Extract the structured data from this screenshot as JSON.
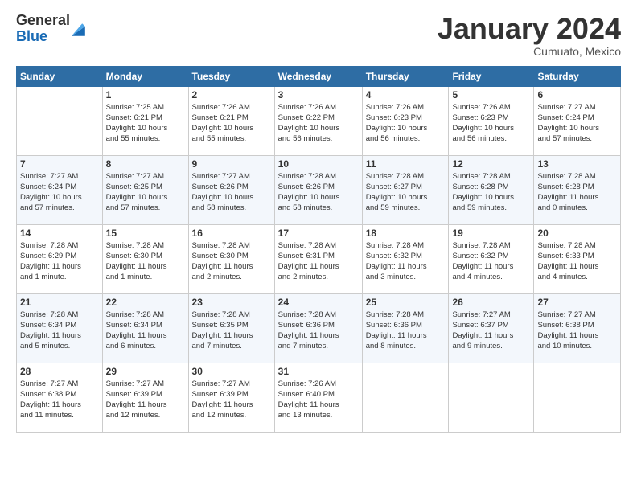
{
  "header": {
    "logo_general": "General",
    "logo_blue": "Blue",
    "month_title": "January 2024",
    "location": "Cumuato, Mexico"
  },
  "days_of_week": [
    "Sunday",
    "Monday",
    "Tuesday",
    "Wednesday",
    "Thursday",
    "Friday",
    "Saturday"
  ],
  "weeks": [
    [
      {
        "day": "",
        "info": ""
      },
      {
        "day": "1",
        "info": "Sunrise: 7:25 AM\nSunset: 6:21 PM\nDaylight: 10 hours\nand 55 minutes."
      },
      {
        "day": "2",
        "info": "Sunrise: 7:26 AM\nSunset: 6:21 PM\nDaylight: 10 hours\nand 55 minutes."
      },
      {
        "day": "3",
        "info": "Sunrise: 7:26 AM\nSunset: 6:22 PM\nDaylight: 10 hours\nand 56 minutes."
      },
      {
        "day": "4",
        "info": "Sunrise: 7:26 AM\nSunset: 6:23 PM\nDaylight: 10 hours\nand 56 minutes."
      },
      {
        "day": "5",
        "info": "Sunrise: 7:26 AM\nSunset: 6:23 PM\nDaylight: 10 hours\nand 56 minutes."
      },
      {
        "day": "6",
        "info": "Sunrise: 7:27 AM\nSunset: 6:24 PM\nDaylight: 10 hours\nand 57 minutes."
      }
    ],
    [
      {
        "day": "7",
        "info": "Sunrise: 7:27 AM\nSunset: 6:24 PM\nDaylight: 10 hours\nand 57 minutes."
      },
      {
        "day": "8",
        "info": "Sunrise: 7:27 AM\nSunset: 6:25 PM\nDaylight: 10 hours\nand 57 minutes."
      },
      {
        "day": "9",
        "info": "Sunrise: 7:27 AM\nSunset: 6:26 PM\nDaylight: 10 hours\nand 58 minutes."
      },
      {
        "day": "10",
        "info": "Sunrise: 7:28 AM\nSunset: 6:26 PM\nDaylight: 10 hours\nand 58 minutes."
      },
      {
        "day": "11",
        "info": "Sunrise: 7:28 AM\nSunset: 6:27 PM\nDaylight: 10 hours\nand 59 minutes."
      },
      {
        "day": "12",
        "info": "Sunrise: 7:28 AM\nSunset: 6:28 PM\nDaylight: 10 hours\nand 59 minutes."
      },
      {
        "day": "13",
        "info": "Sunrise: 7:28 AM\nSunset: 6:28 PM\nDaylight: 11 hours\nand 0 minutes."
      }
    ],
    [
      {
        "day": "14",
        "info": "Sunrise: 7:28 AM\nSunset: 6:29 PM\nDaylight: 11 hours\nand 1 minute."
      },
      {
        "day": "15",
        "info": "Sunrise: 7:28 AM\nSunset: 6:30 PM\nDaylight: 11 hours\nand 1 minute."
      },
      {
        "day": "16",
        "info": "Sunrise: 7:28 AM\nSunset: 6:30 PM\nDaylight: 11 hours\nand 2 minutes."
      },
      {
        "day": "17",
        "info": "Sunrise: 7:28 AM\nSunset: 6:31 PM\nDaylight: 11 hours\nand 2 minutes."
      },
      {
        "day": "18",
        "info": "Sunrise: 7:28 AM\nSunset: 6:32 PM\nDaylight: 11 hours\nand 3 minutes."
      },
      {
        "day": "19",
        "info": "Sunrise: 7:28 AM\nSunset: 6:32 PM\nDaylight: 11 hours\nand 4 minutes."
      },
      {
        "day": "20",
        "info": "Sunrise: 7:28 AM\nSunset: 6:33 PM\nDaylight: 11 hours\nand 4 minutes."
      }
    ],
    [
      {
        "day": "21",
        "info": "Sunrise: 7:28 AM\nSunset: 6:34 PM\nDaylight: 11 hours\nand 5 minutes."
      },
      {
        "day": "22",
        "info": "Sunrise: 7:28 AM\nSunset: 6:34 PM\nDaylight: 11 hours\nand 6 minutes."
      },
      {
        "day": "23",
        "info": "Sunrise: 7:28 AM\nSunset: 6:35 PM\nDaylight: 11 hours\nand 7 minutes."
      },
      {
        "day": "24",
        "info": "Sunrise: 7:28 AM\nSunset: 6:36 PM\nDaylight: 11 hours\nand 7 minutes."
      },
      {
        "day": "25",
        "info": "Sunrise: 7:28 AM\nSunset: 6:36 PM\nDaylight: 11 hours\nand 8 minutes."
      },
      {
        "day": "26",
        "info": "Sunrise: 7:27 AM\nSunset: 6:37 PM\nDaylight: 11 hours\nand 9 minutes."
      },
      {
        "day": "27",
        "info": "Sunrise: 7:27 AM\nSunset: 6:38 PM\nDaylight: 11 hours\nand 10 minutes."
      }
    ],
    [
      {
        "day": "28",
        "info": "Sunrise: 7:27 AM\nSunset: 6:38 PM\nDaylight: 11 hours\nand 11 minutes."
      },
      {
        "day": "29",
        "info": "Sunrise: 7:27 AM\nSunset: 6:39 PM\nDaylight: 11 hours\nand 12 minutes."
      },
      {
        "day": "30",
        "info": "Sunrise: 7:27 AM\nSunset: 6:39 PM\nDaylight: 11 hours\nand 12 minutes."
      },
      {
        "day": "31",
        "info": "Sunrise: 7:26 AM\nSunset: 6:40 PM\nDaylight: 11 hours\nand 13 minutes."
      },
      {
        "day": "",
        "info": ""
      },
      {
        "day": "",
        "info": ""
      },
      {
        "day": "",
        "info": ""
      }
    ]
  ]
}
